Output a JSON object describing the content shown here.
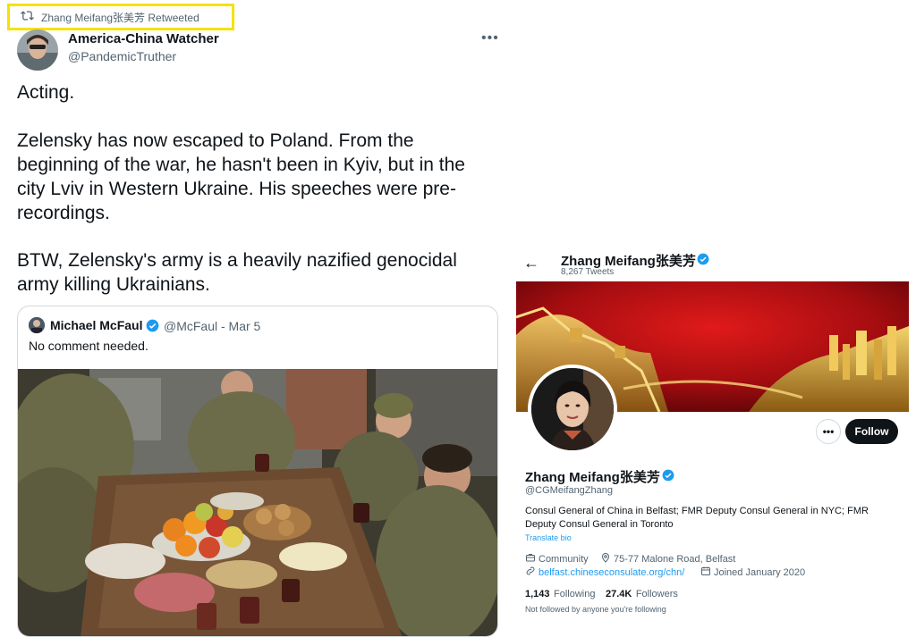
{
  "retweet": {
    "label": "Zhang Meifang张美芳 Retweeted"
  },
  "tweet": {
    "author_name": "America-China Watcher",
    "author_handle": "@PandemicTruther",
    "more": "•••",
    "lines": [
      "Acting.",
      "Zelensky has now escaped to Poland. From the",
      "beginning of the war, he hasn't been in Kyiv, but in the",
      "city Lviv in Western Ukraine. His speeches were pre-",
      "recordings.",
      "BTW, Zelensky's army is a heavily nazified genocidal",
      "army killing Ukrainians."
    ]
  },
  "quote": {
    "name": "Michael McFaul",
    "handle_date": "@McFaul - Mar 5",
    "text": "No comment needed."
  },
  "profile": {
    "back": "←",
    "header_name": "Zhang Meifang张美芳",
    "tweet_count": "8,267 Tweets",
    "more_button": "•••",
    "follow": "Follow",
    "display_name": "Zhang Meifang张美芳",
    "handle": "@CGMeifangZhang",
    "bio": [
      "Consul General of China in Belfast; FMR Deputy Consul General in NYC; FMR",
      "Deputy Consul General in Toronto"
    ],
    "translate": "Translate bio",
    "category": "Community",
    "location": "75-77 Malone Road, Belfast",
    "website": "belfast.chineseconsulate.org/chn/",
    "joined": "Joined January 2020",
    "following_count": "1,143",
    "following_label": "Following",
    "followers_count": "27.4K",
    "followers_label": "Followers",
    "not_followed": "Not followed by anyone you're following"
  },
  "colors": {
    "accent": "#1d9bf0",
    "highlight": "#f6e200",
    "text": "#0f1419",
    "muted": "#536471"
  }
}
